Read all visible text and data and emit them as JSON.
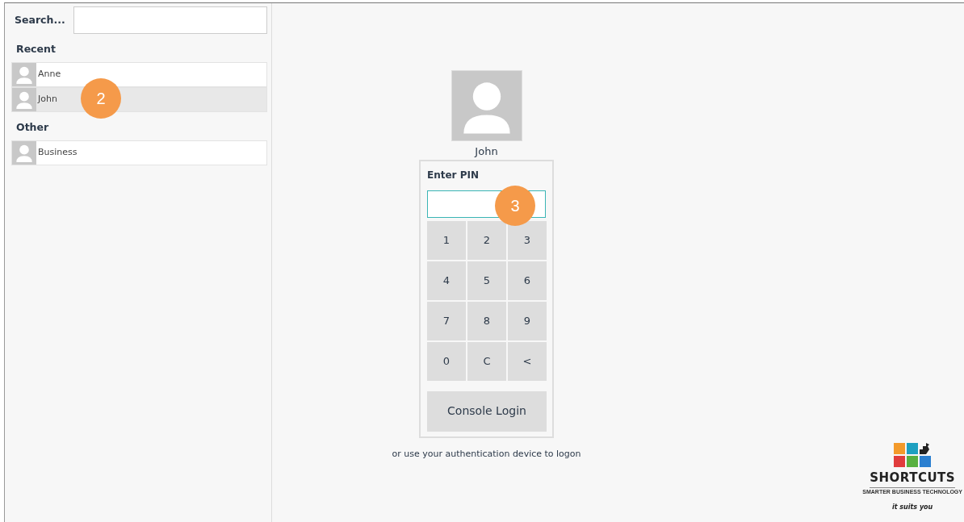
{
  "sidebar": {
    "search_label": "Search...",
    "groups": [
      {
        "title": "Recent",
        "users": [
          {
            "name": "Anne",
            "selected": false
          },
          {
            "name": "John",
            "selected": true
          }
        ]
      },
      {
        "title": "Other",
        "users": [
          {
            "name": "Business",
            "selected": false
          }
        ]
      }
    ]
  },
  "login": {
    "user": "John",
    "pin_label": "Enter PIN",
    "keys": [
      "1",
      "2",
      "3",
      "4",
      "5",
      "6",
      "7",
      "8",
      "9",
      "0",
      "C",
      "<"
    ],
    "submit": "Console Login",
    "hint": "or use your authentication device to logon"
  },
  "logo": {
    "brand": "SHORTCUTS",
    "tagline": "SMARTER BUSINESS TECHNOLOGY",
    "slogan": "it suits you"
  },
  "callouts": [
    {
      "label": "2"
    },
    {
      "label": "3"
    }
  ]
}
